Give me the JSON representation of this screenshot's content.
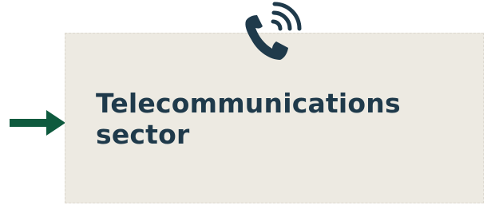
{
  "colors": {
    "card_background": "#edeae2",
    "title_text": "#1f3a4b",
    "icon": "#1f3a4b",
    "arrow": "#0e5a3e"
  },
  "icons": {
    "top": "phone-with-signal-icon",
    "left": "arrow-right-icon"
  },
  "card": {
    "title": "Telecommunications sector"
  }
}
